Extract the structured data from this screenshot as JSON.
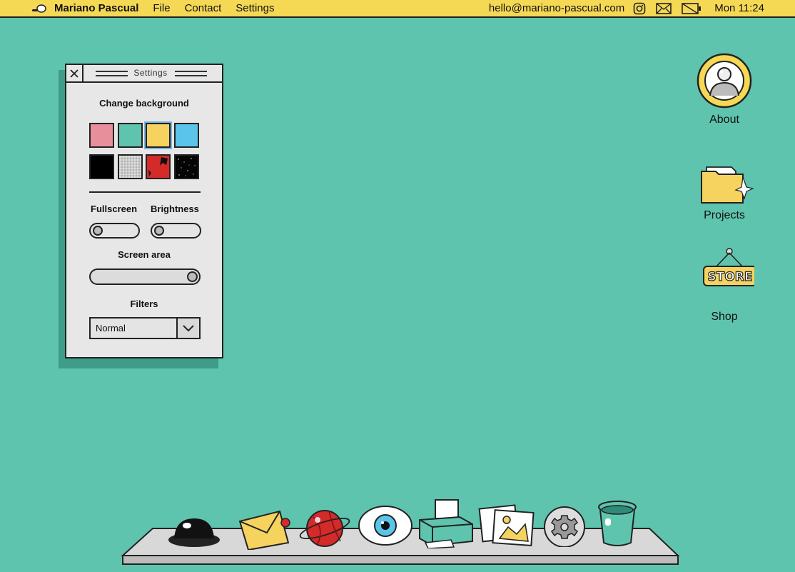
{
  "menubar": {
    "brand": "Mariano Pascual",
    "menu": [
      "File",
      "Contact",
      "Settings"
    ],
    "email": "hello@mariano-pascual.com",
    "clock": "Mon 11:24",
    "icons": [
      "instagram-icon",
      "mail-icon",
      "battery-icon"
    ]
  },
  "settings_window": {
    "title": "Settings",
    "change_background_label": "Change background",
    "swatches": [
      {
        "name": "pink",
        "color": "#e88f9c"
      },
      {
        "name": "teal",
        "color": "#5fc4ae",
        "selected": false
      },
      {
        "name": "yellow",
        "color": "#f5d35e",
        "selected": true
      },
      {
        "name": "blue",
        "color": "#5bc4ea"
      },
      {
        "name": "black",
        "color": "#000000"
      },
      {
        "name": "grid",
        "color": "#e0e0e0"
      },
      {
        "name": "red-pattern",
        "color": "#d42a2a"
      },
      {
        "name": "starfield",
        "color": "#050505"
      }
    ],
    "fullscreen_label": "Fullscreen",
    "brightness_label": "Brightness",
    "screen_area_label": "Screen area",
    "screen_area_value": 1.0,
    "filters_label": "Filters",
    "filter_value": "Normal"
  },
  "desktop": {
    "about_label": "About",
    "projects_label": "Projects",
    "shop_label": "Shop",
    "store_sign_text": "STORE"
  },
  "dock": {
    "items": [
      "hole-icon",
      "mail-icon",
      "planet-icon",
      "eye-icon",
      "printer-icon",
      "photos-icon",
      "settings-gear-icon",
      "trash-bucket-icon"
    ]
  },
  "colors": {
    "background": "#5fc4ae",
    "menubar": "#f5d955",
    "window": "#e7e7e7"
  }
}
